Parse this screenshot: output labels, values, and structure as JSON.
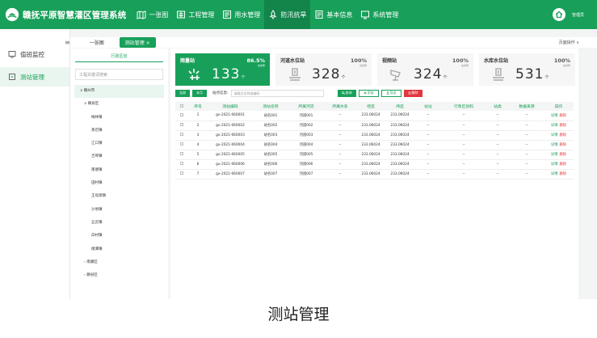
{
  "header": {
    "app_title": "赣抚平原智慧灌区管理系统",
    "nav": [
      {
        "label": "一张图",
        "icon": "map-icon",
        "active": false
      },
      {
        "label": "工程管理",
        "icon": "project-icon",
        "active": false
      },
      {
        "label": "用水管理",
        "icon": "water-use-icon",
        "active": false
      },
      {
        "label": "防汛抗旱",
        "icon": "flood-control-icon",
        "active": true
      },
      {
        "label": "基本信息",
        "icon": "info-icon",
        "active": false
      },
      {
        "label": "系统管理",
        "icon": "system-icon",
        "active": false
      }
    ],
    "user": "管理员",
    "accent_color": "#18a05a"
  },
  "sidebar": {
    "items": [
      {
        "label": "值班监控",
        "icon": "monitor-icon",
        "active": false
      },
      {
        "label": "测站管理",
        "icon": "station-icon",
        "active": true
      }
    ]
  },
  "tabs": {
    "menu_icon": "hamburger-icon",
    "items": [
      {
        "label": "一张图",
        "active": false
      },
      {
        "label": "测站管理 ×",
        "active": true
      }
    ],
    "page_ops": "页面操作 ∨"
  },
  "tree": {
    "title": "行政区划",
    "search_placeholder": "工程关键词搜索",
    "nodes": [
      {
        "label": "∨ 赣州市",
        "level": 1,
        "selected": true
      },
      {
        "label": "∨ 赣县区",
        "level": 2,
        "selected": false
      },
      {
        "label": "梅林镇",
        "level": 3,
        "selected": false
      },
      {
        "label": "茅店镇",
        "level": 3,
        "selected": false
      },
      {
        "label": "江口镇",
        "level": 3,
        "selected": false
      },
      {
        "label": "吉埠镇",
        "level": 3,
        "selected": false
      },
      {
        "label": "南塘镇",
        "level": 3,
        "selected": false
      },
      {
        "label": "田村镇",
        "level": 3,
        "selected": false
      },
      {
        "label": "王母渡镇",
        "level": 3,
        "selected": false
      },
      {
        "label": "沙地镇",
        "level": 3,
        "selected": false
      },
      {
        "label": "五云镇",
        "level": 3,
        "selected": false
      },
      {
        "label": "白村镇",
        "level": 3,
        "selected": false
      },
      {
        "label": "储潭镇",
        "level": 3,
        "selected": false
      },
      {
        "label": "› 南康区",
        "level": 2,
        "selected": false
      },
      {
        "label": "› 赣县区",
        "level": 2,
        "selected": false
      }
    ]
  },
  "cards": [
    {
      "title": "雨量站",
      "percent": "86.5%",
      "percent_label": "在线率",
      "value": "133",
      "unit": "个",
      "icon": "rain-gauge-icon",
      "style": "green"
    },
    {
      "title": "河道水位站",
      "percent": "100%",
      "percent_label": "在线率",
      "value": "328",
      "unit": "个",
      "icon": "water-level-icon",
      "style": "light"
    },
    {
      "title": "视频站",
      "percent": "100%",
      "percent_label": "在线率",
      "value": "324",
      "unit": "个",
      "icon": "camera-icon",
      "style": "light"
    },
    {
      "title": "水库水位站",
      "percent": "100%",
      "percent_label": "在线率",
      "value": "531",
      "unit": "个",
      "icon": "reservoir-icon",
      "style": "light"
    }
  ],
  "filters": {
    "btn_all": "全部",
    "btn_local": "本月",
    "station_label": "站点信息:",
    "station_placeholder": "请输点名称或编码",
    "btn_query": "查询",
    "btn_add": "添加",
    "btn_export": "导出",
    "btn_delete": "删除"
  },
  "table": {
    "columns": [
      "",
      "序号",
      "测站编码",
      "测站名称",
      "所属河流",
      "所属水系",
      "经度",
      "纬度",
      "站址",
      "行政区划码",
      "站类",
      "数据来源",
      "操作"
    ],
    "rows": [
      [
        "1",
        "gx-2021-060001",
        "站名001",
        "河道001",
        "--",
        "233.06024",
        "233.06024",
        "--",
        "--",
        "--",
        "--"
      ],
      [
        "2",
        "gx-2021-060002",
        "站名002",
        "河道002",
        "--",
        "233.06024",
        "233.06024",
        "--",
        "--",
        "--",
        "--"
      ],
      [
        "3",
        "gx-2021-060003",
        "站名003",
        "河道003",
        "--",
        "233.06024",
        "233.06024",
        "--",
        "--",
        "--",
        "--"
      ],
      [
        "4",
        "gx-2021-060004",
        "站名004",
        "河道004",
        "--",
        "233.06024",
        "233.06024",
        "--",
        "--",
        "--",
        "--"
      ],
      [
        "5",
        "gx-2021-060005",
        "站名005",
        "河道005",
        "--",
        "233.06024",
        "233.06024",
        "--",
        "--",
        "--",
        "--"
      ],
      [
        "6",
        "gx-2021-060006",
        "站名006",
        "河道006",
        "--",
        "233.06024",
        "233.06024",
        "--",
        "--",
        "--",
        "--"
      ],
      [
        "7",
        "gx-2021-060007",
        "站名007",
        "河道007",
        "--",
        "233.06024",
        "233.06024",
        "--",
        "--",
        "--",
        "--"
      ]
    ],
    "op_edit": "详情",
    "op_delete": "删除"
  },
  "caption": "测站管理"
}
